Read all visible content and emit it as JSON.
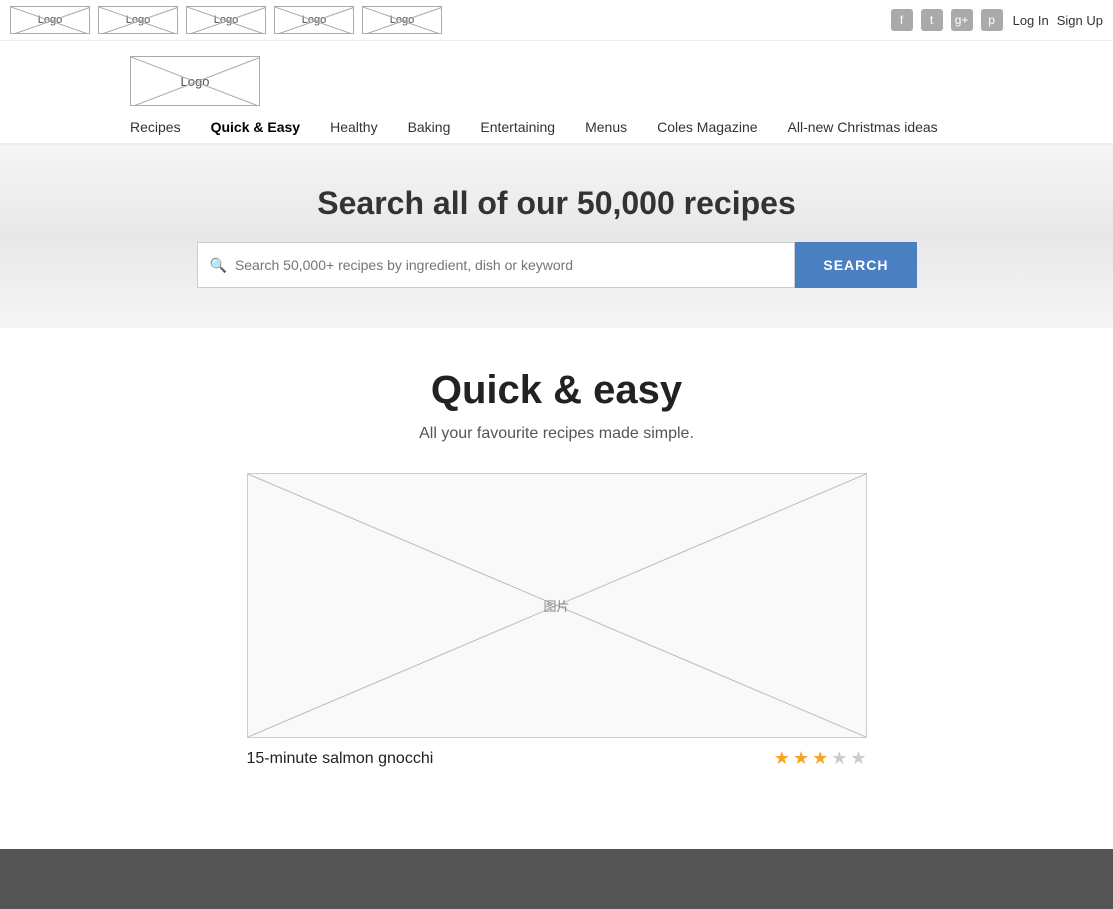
{
  "topBar": {
    "logos": [
      "Logo",
      "Logo",
      "Logo",
      "Logo",
      "Logo"
    ],
    "socialIcons": [
      {
        "name": "facebook-icon",
        "label": "f"
      },
      {
        "name": "twitter-icon",
        "label": "t"
      },
      {
        "name": "googleplus-icon",
        "label": "g+"
      },
      {
        "name": "pinterest-icon",
        "label": "p"
      }
    ],
    "auth": {
      "login": "Log In",
      "signup": "Sign Up"
    }
  },
  "mainLogo": "Logo",
  "mainNav": [
    {
      "label": "Recipes",
      "active": false
    },
    {
      "label": "Quick & Easy",
      "active": true
    },
    {
      "label": "Healthy",
      "active": false
    },
    {
      "label": "Baking",
      "active": false
    },
    {
      "label": "Entertaining",
      "active": false
    },
    {
      "label": "Menus",
      "active": false
    },
    {
      "label": "Coles Magazine",
      "active": false
    },
    {
      "label": "All-new Christmas ideas",
      "active": false
    }
  ],
  "searchHero": {
    "title": "Search all of our 50,000 recipes",
    "inputPlaceholder": "Search 50,000+ recipes by ingredient, dish or keyword",
    "buttonLabel": "SEARCH"
  },
  "pageContent": {
    "title": "Quick & easy",
    "subtitle": "All your favourite recipes made simple.",
    "recipe": {
      "imageAlt": "图片",
      "title": "15-minute salmon gnocchi",
      "stars": [
        true,
        true,
        true,
        false,
        false
      ]
    }
  }
}
